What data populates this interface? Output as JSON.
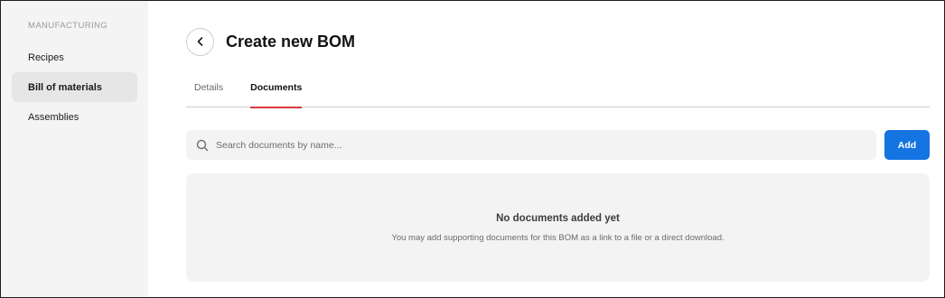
{
  "sidebar": {
    "section_label": "MANUFACTURING",
    "items": [
      {
        "label": "Recipes"
      },
      {
        "label": "Bill of materials"
      },
      {
        "label": "Assemblies"
      }
    ]
  },
  "header": {
    "back_icon": "chevron-left-icon",
    "title": "Create new BOM"
  },
  "tabs": [
    {
      "label": "Details"
    },
    {
      "label": "Documents"
    }
  ],
  "search": {
    "icon": "search-icon",
    "placeholder": "Search documents by name...",
    "value": ""
  },
  "toolbar": {
    "add_label": "Add"
  },
  "empty_state": {
    "title": "No documents added yet",
    "description": "You may add supporting documents for this BOM as a link to a file or a direct download."
  },
  "colors": {
    "accent": "#1474e1",
    "active_tab_underline": "#d9383e"
  }
}
